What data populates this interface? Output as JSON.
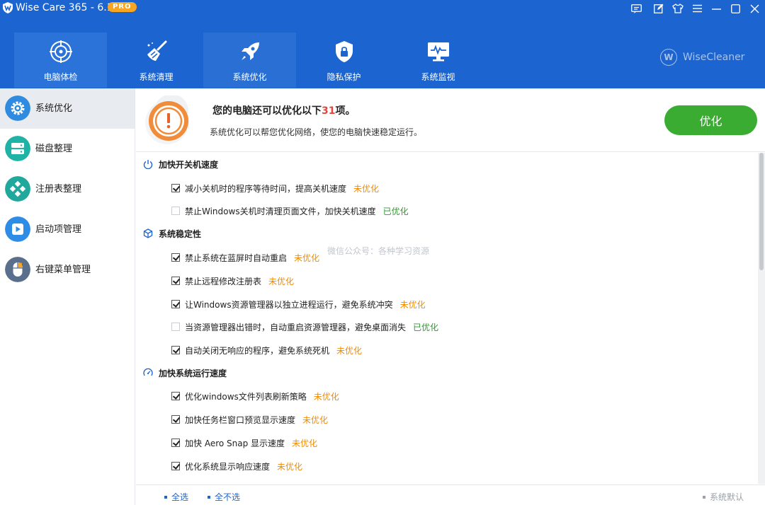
{
  "app": {
    "title": "Wise Care 365 - 6.1.7",
    "edition_badge": "PRO",
    "brand": "WiseCleaner",
    "brand_mark": "W"
  },
  "window_controls": [
    "feedback-icon",
    "edit-icon",
    "skin-icon",
    "menu-icon",
    "minimize-icon",
    "maximize-icon",
    "close-icon"
  ],
  "nav_tabs": [
    {
      "label": "电脑体检",
      "icon": "target-icon",
      "state": "active"
    },
    {
      "label": "系统清理",
      "icon": "broom-icon",
      "state": "normal"
    },
    {
      "label": "系统优化",
      "icon": "rocket-icon",
      "state": "selected"
    },
    {
      "label": "隐私保护",
      "icon": "shield-lock-icon",
      "state": "normal"
    },
    {
      "label": "系统监视",
      "icon": "monitor-icon",
      "state": "normal"
    }
  ],
  "sidebar": {
    "items": [
      {
        "label": "系统优化",
        "icon": "gear-icon",
        "color": "#2f8be0",
        "active": true
      },
      {
        "label": "磁盘整理",
        "icon": "disk-icon",
        "color": "#1fb3a6",
        "active": false
      },
      {
        "label": "注册表整理",
        "icon": "registry-icon",
        "color": "#1fa89b",
        "active": false
      },
      {
        "label": "启动项管理",
        "icon": "play-icon",
        "color": "#2d8ce6",
        "active": false
      },
      {
        "label": "右键菜单管理",
        "icon": "mouse-icon",
        "color": "#5a6f8c",
        "active": false
      }
    ]
  },
  "banner": {
    "title_prefix": "您的电脑还可以优化以下",
    "count": "31",
    "title_suffix": "项。",
    "subtitle": "系统优化可以帮您优化网络，使您的电脑快速稳定运行。",
    "button": "优化"
  },
  "sections": [
    {
      "title": "加快开关机速度",
      "icon": "power-icon",
      "items": [
        {
          "text": "减小关机时的程序等待时间，提高关机速度",
          "status": "未优化",
          "checked": true
        },
        {
          "text": "禁止Windows关机时清理页面文件，加快关机速度",
          "status": "已优化",
          "checked": false
        }
      ]
    },
    {
      "title": "系统稳定性",
      "icon": "cube-icon",
      "items": [
        {
          "text": "禁止系统在蓝屏时自动重启",
          "status": "未优化",
          "checked": true
        },
        {
          "text": "禁止远程修改注册表",
          "status": "未优化",
          "checked": true
        },
        {
          "text": "让Windows资源管理器以独立进程运行，避免系统冲突",
          "status": "未优化",
          "checked": true
        },
        {
          "text": "当资源管理器出错时，自动重启资源管理器，避免桌面消失",
          "status": "已优化",
          "checked": false
        },
        {
          "text": "自动关闭无响应的程序，避免系统死机",
          "status": "未优化",
          "checked": true
        }
      ]
    },
    {
      "title": "加快系统运行速度",
      "icon": "speedometer-icon",
      "items": [
        {
          "text": "优化windows文件列表刷新策略",
          "status": "未优化",
          "checked": true
        },
        {
          "text": "加快任务栏窗口预览显示速度",
          "status": "未优化",
          "checked": true
        },
        {
          "text": "加快 Aero Snap 显示速度",
          "status": "未优化",
          "checked": true
        },
        {
          "text": "优化系统显示响应速度",
          "status": "未优化",
          "checked": true
        }
      ]
    }
  ],
  "watermark": "微信公众号：各种学习资源",
  "footer": {
    "select_all": "全选",
    "select_none": "全不选",
    "system_default": "系统默认"
  },
  "colors": {
    "header": "#1c64cf",
    "pending": "#f08c00",
    "done": "#2e9a2e",
    "button": "#3aac32",
    "count": "#e8433b"
  }
}
